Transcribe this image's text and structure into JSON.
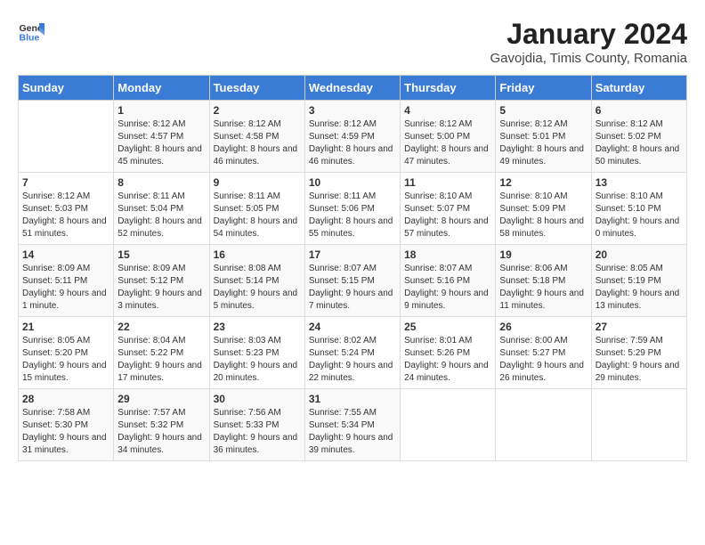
{
  "logo": {
    "general": "General",
    "blue": "Blue"
  },
  "title": "January 2024",
  "subtitle": "Gavojdia, Timis County, Romania",
  "days_header": [
    "Sunday",
    "Monday",
    "Tuesday",
    "Wednesday",
    "Thursday",
    "Friday",
    "Saturday"
  ],
  "weeks": [
    [
      {
        "day": "",
        "sunrise": "",
        "sunset": "",
        "daylight": ""
      },
      {
        "day": "1",
        "sunrise": "Sunrise: 8:12 AM",
        "sunset": "Sunset: 4:57 PM",
        "daylight": "Daylight: 8 hours and 45 minutes."
      },
      {
        "day": "2",
        "sunrise": "Sunrise: 8:12 AM",
        "sunset": "Sunset: 4:58 PM",
        "daylight": "Daylight: 8 hours and 46 minutes."
      },
      {
        "day": "3",
        "sunrise": "Sunrise: 8:12 AM",
        "sunset": "Sunset: 4:59 PM",
        "daylight": "Daylight: 8 hours and 46 minutes."
      },
      {
        "day": "4",
        "sunrise": "Sunrise: 8:12 AM",
        "sunset": "Sunset: 5:00 PM",
        "daylight": "Daylight: 8 hours and 47 minutes."
      },
      {
        "day": "5",
        "sunrise": "Sunrise: 8:12 AM",
        "sunset": "Sunset: 5:01 PM",
        "daylight": "Daylight: 8 hours and 49 minutes."
      },
      {
        "day": "6",
        "sunrise": "Sunrise: 8:12 AM",
        "sunset": "Sunset: 5:02 PM",
        "daylight": "Daylight: 8 hours and 50 minutes."
      }
    ],
    [
      {
        "day": "7",
        "sunrise": "Sunrise: 8:12 AM",
        "sunset": "Sunset: 5:03 PM",
        "daylight": "Daylight: 8 hours and 51 minutes."
      },
      {
        "day": "8",
        "sunrise": "Sunrise: 8:11 AM",
        "sunset": "Sunset: 5:04 PM",
        "daylight": "Daylight: 8 hours and 52 minutes."
      },
      {
        "day": "9",
        "sunrise": "Sunrise: 8:11 AM",
        "sunset": "Sunset: 5:05 PM",
        "daylight": "Daylight: 8 hours and 54 minutes."
      },
      {
        "day": "10",
        "sunrise": "Sunrise: 8:11 AM",
        "sunset": "Sunset: 5:06 PM",
        "daylight": "Daylight: 8 hours and 55 minutes."
      },
      {
        "day": "11",
        "sunrise": "Sunrise: 8:10 AM",
        "sunset": "Sunset: 5:07 PM",
        "daylight": "Daylight: 8 hours and 57 minutes."
      },
      {
        "day": "12",
        "sunrise": "Sunrise: 8:10 AM",
        "sunset": "Sunset: 5:09 PM",
        "daylight": "Daylight: 8 hours and 58 minutes."
      },
      {
        "day": "13",
        "sunrise": "Sunrise: 8:10 AM",
        "sunset": "Sunset: 5:10 PM",
        "daylight": "Daylight: 9 hours and 0 minutes."
      }
    ],
    [
      {
        "day": "14",
        "sunrise": "Sunrise: 8:09 AM",
        "sunset": "Sunset: 5:11 PM",
        "daylight": "Daylight: 9 hours and 1 minute."
      },
      {
        "day": "15",
        "sunrise": "Sunrise: 8:09 AM",
        "sunset": "Sunset: 5:12 PM",
        "daylight": "Daylight: 9 hours and 3 minutes."
      },
      {
        "day": "16",
        "sunrise": "Sunrise: 8:08 AM",
        "sunset": "Sunset: 5:14 PM",
        "daylight": "Daylight: 9 hours and 5 minutes."
      },
      {
        "day": "17",
        "sunrise": "Sunrise: 8:07 AM",
        "sunset": "Sunset: 5:15 PM",
        "daylight": "Daylight: 9 hours and 7 minutes."
      },
      {
        "day": "18",
        "sunrise": "Sunrise: 8:07 AM",
        "sunset": "Sunset: 5:16 PM",
        "daylight": "Daylight: 9 hours and 9 minutes."
      },
      {
        "day": "19",
        "sunrise": "Sunrise: 8:06 AM",
        "sunset": "Sunset: 5:18 PM",
        "daylight": "Daylight: 9 hours and 11 minutes."
      },
      {
        "day": "20",
        "sunrise": "Sunrise: 8:05 AM",
        "sunset": "Sunset: 5:19 PM",
        "daylight": "Daylight: 9 hours and 13 minutes."
      }
    ],
    [
      {
        "day": "21",
        "sunrise": "Sunrise: 8:05 AM",
        "sunset": "Sunset: 5:20 PM",
        "daylight": "Daylight: 9 hours and 15 minutes."
      },
      {
        "day": "22",
        "sunrise": "Sunrise: 8:04 AM",
        "sunset": "Sunset: 5:22 PM",
        "daylight": "Daylight: 9 hours and 17 minutes."
      },
      {
        "day": "23",
        "sunrise": "Sunrise: 8:03 AM",
        "sunset": "Sunset: 5:23 PM",
        "daylight": "Daylight: 9 hours and 20 minutes."
      },
      {
        "day": "24",
        "sunrise": "Sunrise: 8:02 AM",
        "sunset": "Sunset: 5:24 PM",
        "daylight": "Daylight: 9 hours and 22 minutes."
      },
      {
        "day": "25",
        "sunrise": "Sunrise: 8:01 AM",
        "sunset": "Sunset: 5:26 PM",
        "daylight": "Daylight: 9 hours and 24 minutes."
      },
      {
        "day": "26",
        "sunrise": "Sunrise: 8:00 AM",
        "sunset": "Sunset: 5:27 PM",
        "daylight": "Daylight: 9 hours and 26 minutes."
      },
      {
        "day": "27",
        "sunrise": "Sunrise: 7:59 AM",
        "sunset": "Sunset: 5:29 PM",
        "daylight": "Daylight: 9 hours and 29 minutes."
      }
    ],
    [
      {
        "day": "28",
        "sunrise": "Sunrise: 7:58 AM",
        "sunset": "Sunset: 5:30 PM",
        "daylight": "Daylight: 9 hours and 31 minutes."
      },
      {
        "day": "29",
        "sunrise": "Sunrise: 7:57 AM",
        "sunset": "Sunset: 5:32 PM",
        "daylight": "Daylight: 9 hours and 34 minutes."
      },
      {
        "day": "30",
        "sunrise": "Sunrise: 7:56 AM",
        "sunset": "Sunset: 5:33 PM",
        "daylight": "Daylight: 9 hours and 36 minutes."
      },
      {
        "day": "31",
        "sunrise": "Sunrise: 7:55 AM",
        "sunset": "Sunset: 5:34 PM",
        "daylight": "Daylight: 9 hours and 39 minutes."
      },
      {
        "day": "",
        "sunrise": "",
        "sunset": "",
        "daylight": ""
      },
      {
        "day": "",
        "sunrise": "",
        "sunset": "",
        "daylight": ""
      },
      {
        "day": "",
        "sunrise": "",
        "sunset": "",
        "daylight": ""
      }
    ]
  ]
}
